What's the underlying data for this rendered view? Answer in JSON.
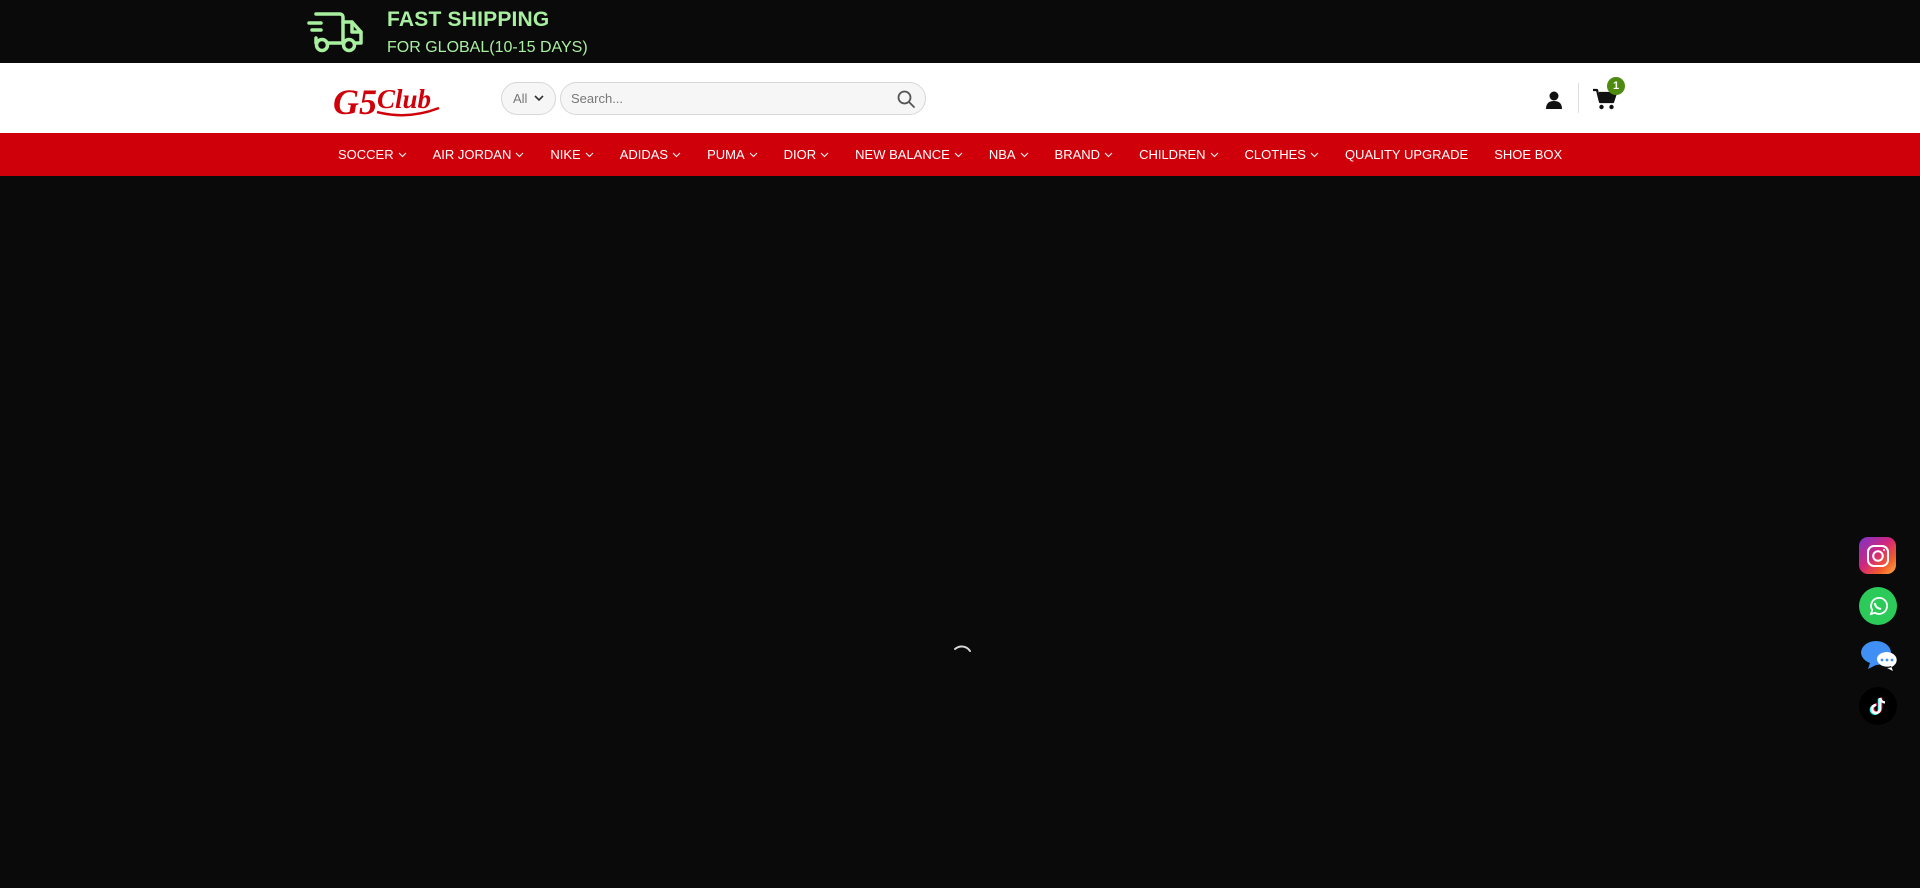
{
  "promo": {
    "title": "FAST SHIPPING",
    "subtitle": "FOR GLOBAL(10-15 DAYS)",
    "icon": "truck-icon",
    "color": "#a8f0a0"
  },
  "header": {
    "logo_text": "G5Club",
    "category_select": "All",
    "search_placeholder": "Search...",
    "cart_count": "1",
    "brand_color": "#d0000a"
  },
  "nav": {
    "items": [
      {
        "label": "SOCCER",
        "dropdown": true
      },
      {
        "label": "AIR JORDAN",
        "dropdown": true
      },
      {
        "label": "NIKE",
        "dropdown": true
      },
      {
        "label": "ADIDAS",
        "dropdown": true
      },
      {
        "label": "PUMA",
        "dropdown": true
      },
      {
        "label": "DIOR",
        "dropdown": true
      },
      {
        "label": "NEW BALANCE",
        "dropdown": true
      },
      {
        "label": "NBA",
        "dropdown": true
      },
      {
        "label": "BRAND",
        "dropdown": true
      },
      {
        "label": "CHILDREN",
        "dropdown": true
      },
      {
        "label": "CLOTHES",
        "dropdown": true
      },
      {
        "label": "QUALITY UPGRADE",
        "dropdown": false
      },
      {
        "label": "SHOE BOX",
        "dropdown": false
      }
    ]
  },
  "social": [
    "instagram-icon",
    "whatsapp-icon",
    "chat-icon",
    "tiktok-icon"
  ]
}
